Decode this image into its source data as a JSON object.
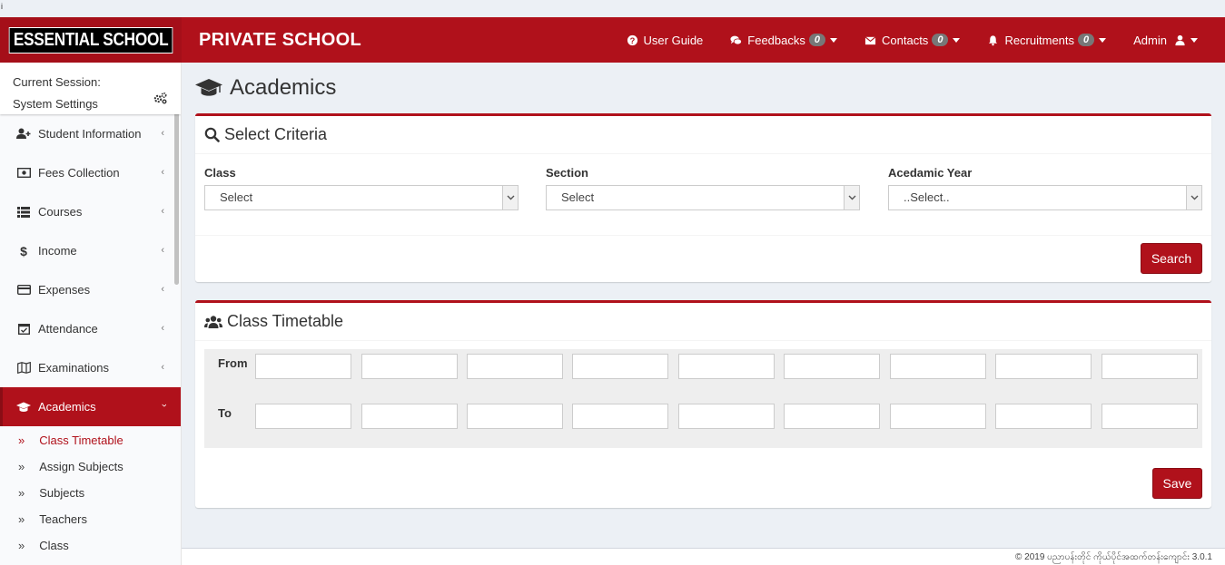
{
  "corner_mark": "i",
  "header": {
    "logo": "ESSENTIAL SCHOOL",
    "brand": "PRIVATE SCHOOL",
    "nav": {
      "user_guide": "User Guide",
      "feedbacks": "Feedbacks",
      "feedbacks_count": "0",
      "contacts": "Contacts",
      "contacts_count": "0",
      "recruitments": "Recruitments",
      "recruitments_count": "0",
      "admin": "Admin"
    }
  },
  "sidebar": {
    "session_label": "Current Session:",
    "settings_label": "System Settings",
    "items": [
      {
        "label": "Student Information",
        "icon": "user-plus-icon"
      },
      {
        "label": "Fees Collection",
        "icon": "money-icon"
      },
      {
        "label": "Courses",
        "icon": "list-icon"
      },
      {
        "label": "Income",
        "icon": "dollar-icon"
      },
      {
        "label": "Expenses",
        "icon": "credit-card-icon"
      },
      {
        "label": "Attendance",
        "icon": "calendar-check-icon"
      },
      {
        "label": "Examinations",
        "icon": "map-icon"
      },
      {
        "label": "Academics",
        "icon": "graduation-cap-icon"
      }
    ],
    "subitems": [
      "Class Timetable",
      "Assign Subjects",
      "Subjects",
      "Teachers",
      "Class"
    ]
  },
  "main": {
    "page_title": "Academics",
    "criteria": {
      "title": "Select Criteria",
      "class_label": "Class",
      "class_value": "Select",
      "section_label": "Section",
      "section_value": "Select",
      "year_label": "Acedamic Year",
      "year_value": "..Select..",
      "search_button": "Search"
    },
    "timetable": {
      "title": "Class Timetable",
      "from_label": "From",
      "to_label": "To",
      "save_button": "Save"
    }
  },
  "footer": {
    "text": "© 2019 ပညာပန်းတိုင် ကိုယ်ပိုင်အထက်တန်းကျောင်း 3.0.1"
  },
  "colors": {
    "brand_red": "#b0111b",
    "badge_gray": "#777777",
    "background": "#ecf0f5"
  }
}
